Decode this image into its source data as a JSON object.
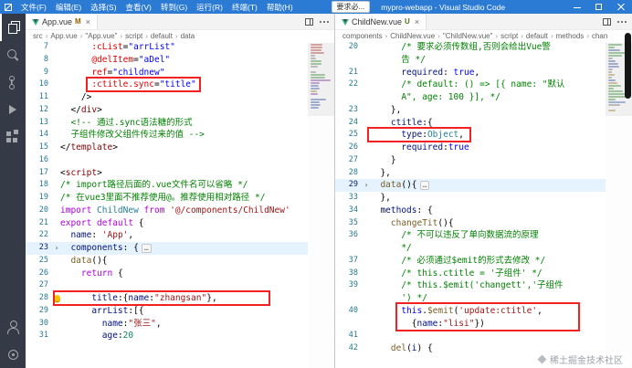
{
  "colors": {
    "titlebar": "#2b7bd4",
    "activitybar": "#343a46",
    "annotation_red": "#f32222",
    "vue_green": "#41b883",
    "badge_modified": "#946300",
    "badge_untracked": "#4d7a18",
    "comment_green": "#008000",
    "string_red": "#a31515",
    "keyword_purple": "#af00db",
    "keyword_blue": "#0000ff",
    "property_blue": "#001080",
    "function_brown": "#795e26",
    "class_teal": "#267f99",
    "number_green": "#098658",
    "tag_maroon": "#800000",
    "attr_red": "#e50000",
    "line_number": "#237893"
  },
  "title_bar": {
    "menus": [
      "文件(F)",
      "编辑(E)",
      "选择(S)",
      "查看(V)",
      "转到(G)",
      "运行(R)",
      "终端(T)",
      "帮助(H)"
    ],
    "overlay_text": "要求必...",
    "title": "mypro-webapp - Visual Studio Code"
  },
  "watermark": {
    "text": "稀土掘金技术社区"
  },
  "left_editor": {
    "tab": {
      "label": "App.vue",
      "badge": "M",
      "close": "×"
    },
    "breadcrumb": [
      "src",
      "App.vue",
      "\"App.vue\"",
      "script",
      "default",
      "data"
    ],
    "lines": [
      {
        "num": "7",
        "tokens": [
          [
            "ind",
            "      "
          ],
          [
            "attr",
            ":cList"
          ],
          [
            "pun",
            "="
          ],
          [
            "aval",
            "\"arrList\""
          ]
        ]
      },
      {
        "num": "8",
        "tokens": [
          [
            "ind",
            "      "
          ],
          [
            "attr",
            "@delItem"
          ],
          [
            "pun",
            "="
          ],
          [
            "aval",
            "\"aDel\""
          ]
        ]
      },
      {
        "num": "9",
        "tokens": [
          [
            "ind",
            "      "
          ],
          [
            "attr",
            "ref"
          ],
          [
            "pun",
            "="
          ],
          [
            "aval",
            "\"childnew\""
          ]
        ]
      },
      {
        "num": "10",
        "tokens": [
          [
            "ind",
            "      "
          ],
          [
            "attr",
            ":ctitle.sync"
          ],
          [
            "pun",
            "="
          ],
          [
            "aval",
            "\"title\""
          ]
        ]
      },
      {
        "num": "11",
        "tokens": [
          [
            "ind",
            "    "
          ],
          [
            "pun",
            "/>"
          ]
        ]
      },
      {
        "num": "12",
        "tokens": [
          [
            "ind",
            "  "
          ],
          [
            "pun",
            "</"
          ],
          [
            "tag",
            "div"
          ],
          [
            "pun",
            ">"
          ]
        ]
      },
      {
        "num": "13",
        "tokens": [
          [
            "ind",
            "  "
          ],
          [
            "com",
            "<!-- 通过.sync语法糖的形式"
          ]
        ]
      },
      {
        "num": "14",
        "tokens": [
          [
            "ind",
            "  "
          ],
          [
            "com",
            "子组件修改父组件传过来的值 -->"
          ]
        ]
      },
      {
        "num": "15",
        "tokens": [
          [
            "pun",
            "</"
          ],
          [
            "tag",
            "template"
          ],
          [
            "pun",
            ">"
          ]
        ]
      },
      {
        "num": "16",
        "tokens": []
      },
      {
        "num": "17",
        "tokens": [
          [
            "pun",
            "<"
          ],
          [
            "tag",
            "script"
          ],
          [
            "pun",
            ">"
          ]
        ]
      },
      {
        "num": "18",
        "tokens": [
          [
            "com",
            "/* import路径后面的.vue文件名可以省略 */"
          ]
        ]
      },
      {
        "num": "19",
        "tokens": [
          [
            "com",
            "/* 在vue3里面不推荐使用@。推荐使用相对路径 */"
          ]
        ]
      },
      {
        "num": "20",
        "tokens": [
          [
            "kw",
            "import "
          ],
          [
            "cls",
            "ChildNew "
          ],
          [
            "kw",
            "from "
          ],
          [
            "str",
            "'@/components/ChildNew'"
          ]
        ]
      },
      {
        "num": "21",
        "tokens": [
          [
            "kw",
            "export default "
          ],
          [
            "pun",
            "{"
          ]
        ]
      },
      {
        "num": "22",
        "tokens": [
          [
            "ind",
            "  "
          ],
          [
            "prop",
            "name"
          ],
          [
            "pun",
            ": "
          ],
          [
            "str",
            "'App'"
          ],
          [
            "pun",
            ","
          ]
        ]
      },
      {
        "num": "23",
        "fold": true,
        "hl": true,
        "tokens": [
          [
            "ind",
            "  "
          ],
          [
            "prop",
            "components"
          ],
          [
            "pun",
            ": {"
          ],
          [
            "fold",
            "…"
          ]
        ]
      },
      {
        "num": "25",
        "tokens": [
          [
            "ind",
            "  "
          ],
          [
            "fn",
            "data"
          ],
          [
            "pun",
            "(){"
          ]
        ]
      },
      {
        "num": "26",
        "tokens": [
          [
            "ind",
            "    "
          ],
          [
            "kw",
            "return "
          ],
          [
            "pun",
            "{"
          ]
        ]
      },
      {
        "num": "27",
        "tokens": []
      },
      {
        "num": "28",
        "bulb": true,
        "tokens": [
          [
            "ind",
            "      "
          ],
          [
            "prop",
            "title"
          ],
          [
            "pun",
            ":{"
          ],
          [
            "prop",
            "name"
          ],
          [
            "pun",
            ":"
          ],
          [
            "str",
            "\"zhangsan\""
          ],
          [
            "pun",
            "},"
          ]
        ]
      },
      {
        "num": "29",
        "tokens": [
          [
            "ind",
            "      "
          ],
          [
            "prop",
            "arrList"
          ],
          [
            "pun",
            ":[{"
          ]
        ]
      },
      {
        "num": "30",
        "tokens": [
          [
            "ind",
            "        "
          ],
          [
            "prop",
            "name"
          ],
          [
            "pun",
            ":"
          ],
          [
            "str",
            "\"张三\""
          ],
          [
            "pun",
            ","
          ]
        ]
      },
      {
        "num": "31",
        "tokens": [
          [
            "ind",
            "        "
          ],
          [
            "prop",
            "age"
          ],
          [
            "pun",
            ":"
          ],
          [
            "num",
            "20"
          ]
        ]
      }
    ]
  },
  "right_editor": {
    "tab": {
      "label": "ChildNew.vue",
      "badge": "U",
      "close": "×"
    },
    "breadcrumb": [
      "components",
      "ChildNew.vue",
      "\"ChildNew.vue\"",
      "script",
      "default",
      "methods",
      "chan"
    ],
    "lines": [
      {
        "num": "20",
        "tokens": [
          [
            "ind",
            "      "
          ],
          [
            "com",
            "/* 要求必须传数组,否则会给出Vue警"
          ]
        ]
      },
      {
        "num": "",
        "tokens": [
          [
            "ind",
            "      "
          ],
          [
            "com",
            "告 */"
          ]
        ]
      },
      {
        "num": "21",
        "tokens": [
          [
            "ind",
            "      "
          ],
          [
            "prop",
            "required"
          ],
          [
            "pun",
            ": "
          ],
          [
            "kwb",
            "true"
          ],
          [
            "pun",
            ","
          ]
        ]
      },
      {
        "num": "22",
        "tokens": [
          [
            "ind",
            "      "
          ],
          [
            "com",
            "/* default: () => [{ name: \"默认"
          ]
        ]
      },
      {
        "num": "",
        "tokens": [
          [
            "ind",
            "      "
          ],
          [
            "com",
            "A\", age: 100 }], */"
          ]
        ]
      },
      {
        "num": "23",
        "tokens": [
          [
            "ind",
            "    "
          ],
          [
            "pun",
            "},"
          ]
        ]
      },
      {
        "num": "24",
        "tokens": [
          [
            "ind",
            "    "
          ],
          [
            "prop",
            "ctitle"
          ],
          [
            "pun",
            ":{"
          ]
        ]
      },
      {
        "num": "25",
        "tokens": [
          [
            "ind",
            "      "
          ],
          [
            "prop",
            "type"
          ],
          [
            "pun",
            ":"
          ],
          [
            "cls",
            "Object"
          ],
          [
            "pun",
            ","
          ]
        ]
      },
      {
        "num": "26",
        "tokens": [
          [
            "ind",
            "      "
          ],
          [
            "prop",
            "required"
          ],
          [
            "pun",
            ":"
          ],
          [
            "kwb",
            "true"
          ]
        ]
      },
      {
        "num": "27",
        "tokens": [
          [
            "ind",
            "    "
          ],
          [
            "pun",
            "}"
          ]
        ]
      },
      {
        "num": "28",
        "tokens": [
          [
            "ind",
            "  "
          ],
          [
            "pun",
            "},"
          ]
        ]
      },
      {
        "num": "29",
        "fold": true,
        "hl": true,
        "tokens": [
          [
            "ind",
            "  "
          ],
          [
            "fn",
            "data"
          ],
          [
            "pun",
            "(){"
          ],
          [
            "fold",
            "…"
          ]
        ]
      },
      {
        "num": "33",
        "tokens": [
          [
            "ind",
            "  "
          ],
          [
            "pun",
            "},"
          ]
        ]
      },
      {
        "num": "34",
        "tokens": [
          [
            "ind",
            "  "
          ],
          [
            "prop",
            "methods"
          ],
          [
            "pun",
            ": {"
          ]
        ]
      },
      {
        "num": "35",
        "tokens": [
          [
            "ind",
            "    "
          ],
          [
            "fn",
            "changeTit"
          ],
          [
            "pun",
            "(){"
          ]
        ]
      },
      {
        "num": "36",
        "tokens": [
          [
            "ind",
            "      "
          ],
          [
            "com",
            "/* 不可以违反了单向数据流的原理"
          ]
        ]
      },
      {
        "num": "",
        "tokens": [
          [
            "ind",
            "      "
          ],
          [
            "com",
            "*/"
          ]
        ]
      },
      {
        "num": "37",
        "tokens": [
          [
            "ind",
            "      "
          ],
          [
            "com",
            "/* 必须通过$emit的形式去修改 */"
          ]
        ]
      },
      {
        "num": "38",
        "tokens": [
          [
            "ind",
            "      "
          ],
          [
            "com",
            "/* this.ctitle = '子组件' */"
          ]
        ]
      },
      {
        "num": "39",
        "tokens": [
          [
            "ind",
            "      "
          ],
          [
            "com",
            "/* this.$emit('changett','子组件"
          ]
        ]
      },
      {
        "num": "",
        "tokens": [
          [
            "ind",
            "      "
          ],
          [
            "com",
            "') */"
          ]
        ]
      },
      {
        "num": "40",
        "tokens": [
          [
            "ind",
            "      "
          ],
          [
            "kwb",
            "this"
          ],
          [
            "pun",
            "."
          ],
          [
            "fn",
            "$emit"
          ],
          [
            "pun",
            "("
          ],
          [
            "str",
            "'update:ctitle'"
          ],
          [
            "pun",
            ","
          ]
        ]
      },
      {
        "num": "",
        "tokens": [
          [
            "ind",
            "        "
          ],
          [
            "pun",
            "{"
          ],
          [
            "prop",
            "name"
          ],
          [
            "pun",
            ":"
          ],
          [
            "str",
            "\"lisi\""
          ],
          [
            "pun",
            "})"
          ]
        ]
      },
      {
        "num": "41",
        "tokens": []
      },
      {
        "num": "42",
        "tokens": [
          [
            "ind",
            "    "
          ],
          [
            "fn",
            "del"
          ],
          [
            "pun",
            "("
          ],
          [
            "prop",
            "i"
          ],
          [
            "pun",
            ") {"
          ]
        ]
      }
    ]
  }
}
